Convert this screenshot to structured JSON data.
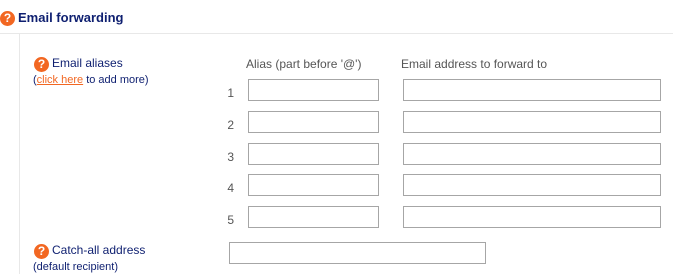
{
  "section": {
    "title": "Email forwarding",
    "help_icon": "question-circle-icon"
  },
  "aliases": {
    "label": "Email aliases",
    "sub_open": "(",
    "sub_link": "click here",
    "sub_close": " to add more)",
    "help_icon": "question-circle-icon",
    "columns": {
      "alias": "Alias (part before '@')",
      "email": "Email address to forward to"
    },
    "rows": [
      {
        "number": "1",
        "alias": "",
        "email": ""
      },
      {
        "number": "2",
        "alias": "",
        "email": ""
      },
      {
        "number": "3",
        "alias": "",
        "email": ""
      },
      {
        "number": "4",
        "alias": "",
        "email": ""
      },
      {
        "number": "5",
        "alias": "",
        "email": ""
      }
    ]
  },
  "catchall": {
    "label": "Catch-all address",
    "sub": "(default recipient)",
    "value": "",
    "help_icon": "question-circle-icon"
  },
  "colors": {
    "heading": "#0e1f70",
    "accent": "#f26722",
    "muted_text": "#555555",
    "field_border": "#a6a6a6"
  }
}
